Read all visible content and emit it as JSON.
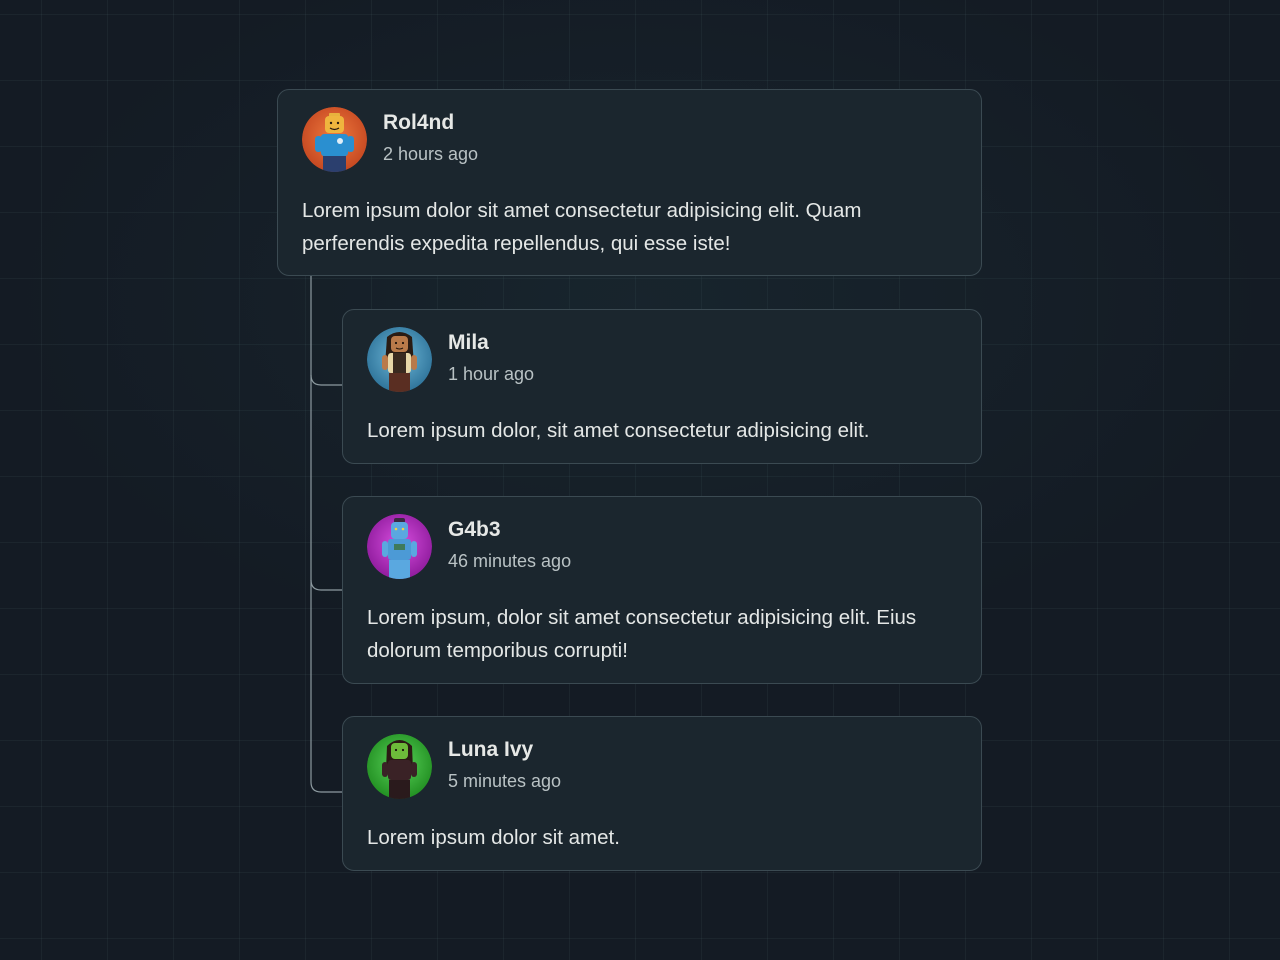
{
  "comments": [
    {
      "name": "Rol4nd",
      "time": "2 hours ago",
      "text": "Lorem ipsum dolor sit amet consectetur adipisicing elit. Quam perferendis expedita repellendus, qui esse iste!",
      "avatar_color": "#d4532a"
    },
    {
      "name": "Mila",
      "time": "1 hour ago",
      "text": "Lorem ipsum dolor, sit amet consectetur adipisicing elit.",
      "avatar_color": "#3b8fb5"
    },
    {
      "name": "G4b3",
      "time": "46 minutes ago",
      "text": "Lorem ipsum, dolor sit amet consectetur adipisicing elit. Eius dolorum temporibus corrupti!",
      "avatar_color": "#b025c0"
    },
    {
      "name": "Luna Ivy",
      "time": "5 minutes ago",
      "text": "Lorem ipsum dolor sit amet.",
      "avatar_color": "#2fae2f"
    }
  ],
  "colors": {
    "background": "#141b24",
    "card": "#1b262e",
    "card_border": "#3b4a52",
    "connector": "#8d9aa0"
  }
}
